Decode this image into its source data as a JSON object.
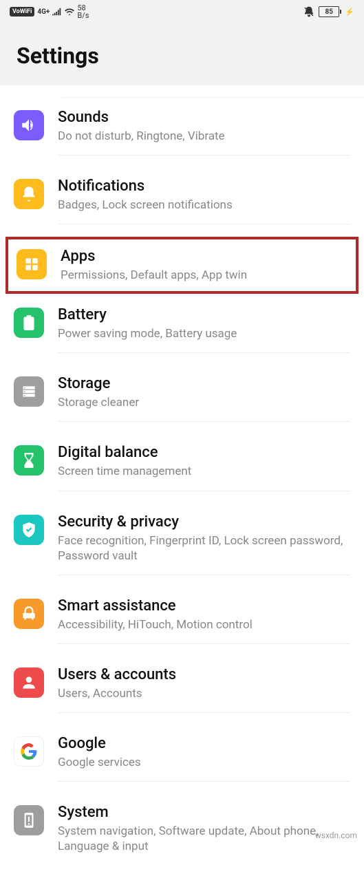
{
  "status": {
    "vowifi": "VoWiFi",
    "network": "4G+",
    "rate_top": "58",
    "rate_bottom": "B/s",
    "battery": "85",
    "charging": "⚡"
  },
  "header": {
    "title": "Settings"
  },
  "items": [
    {
      "id": "sounds",
      "title": "Sounds",
      "subtitle": "Do not disturb, Ringtone, Vibrate",
      "color": "#7b5cff"
    },
    {
      "id": "notifications",
      "title": "Notifications",
      "subtitle": "Badges, Lock screen notifications",
      "color": "#fdbb1c"
    },
    {
      "id": "apps",
      "title": "Apps",
      "subtitle": "Permissions, Default apps, App twin",
      "color": "#fdbb1c",
      "highlighted": true
    },
    {
      "id": "battery",
      "title": "Battery",
      "subtitle": "Power saving mode, Battery usage",
      "color": "#23c26b"
    },
    {
      "id": "storage",
      "title": "Storage",
      "subtitle": "Storage cleaner",
      "color": "#9e9e9e"
    },
    {
      "id": "digital-balance",
      "title": "Digital balance",
      "subtitle": "Screen time management",
      "color": "#23c26b"
    },
    {
      "id": "security",
      "title": "Security & privacy",
      "subtitle": "Face recognition, Fingerprint ID, Lock screen password, Password vault",
      "color": "#1bc7c0"
    },
    {
      "id": "smart-assistance",
      "title": "Smart assistance",
      "subtitle": "Accessibility, HiTouch, Motion control",
      "color": "#f79a2a"
    },
    {
      "id": "users",
      "title": "Users & accounts",
      "subtitle": "Users, Accounts",
      "color": "#ef4b4b"
    },
    {
      "id": "google",
      "title": "Google",
      "subtitle": "Google services",
      "color": "#ffffff"
    },
    {
      "id": "system",
      "title": "System",
      "subtitle": "System navigation, Software update, About phone, Language & input",
      "color": "#9e9e9e"
    }
  ],
  "watermark": "wsxdn.com"
}
